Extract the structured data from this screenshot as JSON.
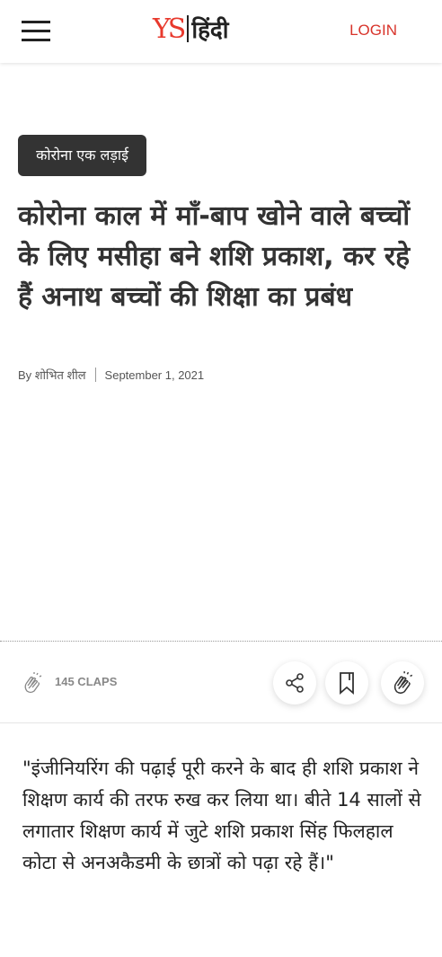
{
  "header": {
    "logo_ys": "YS",
    "logo_hindi": "हिंदी",
    "login_label": "LOGIN"
  },
  "article": {
    "category": "कोरोना एक लड़ाई",
    "title": "कोरोना काल में माँ-बाप खोने वाले बच्चों के लिए मसीहा बने शशि प्रकाश, कर रहे हैं अनाथ बच्चों की शिक्षा का प्रबंध",
    "author": "By शोभित शील",
    "date": "September 1, 2021"
  },
  "actions": {
    "claps_label": "145 CLAPS",
    "icons": [
      "clap-icon",
      "share-icon",
      "bookmark-icon",
      "clap-button-icon"
    ]
  },
  "body": {
    "quote": "\"इंजीनियरिंग की पढ़ाई पूरी करने के बाद ही शशि प्रकाश ने शिक्षण कार्य की तरफ रुख कर लिया था। बीते 14 सालों से लगातार शिक्षण कार्य में जुटे शशि प्रकाश सिंह फिलहाल कोटा से अनअकैडमी के छात्रों को पढ़ा रहे हैं।\""
  },
  "colors": {
    "accent": "#e8392d",
    "login": "#d8342b",
    "category_bg": "#333333"
  }
}
